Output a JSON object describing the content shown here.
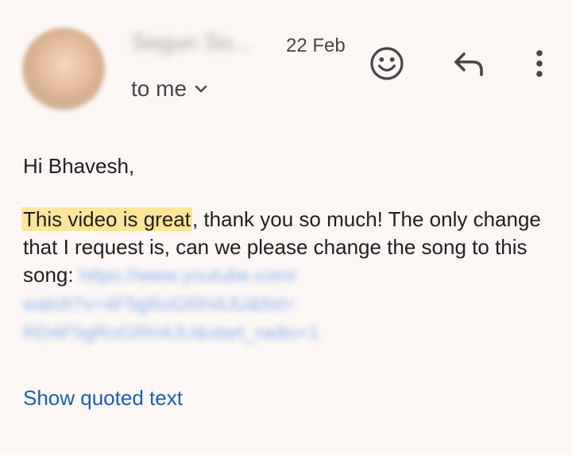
{
  "email": {
    "sender_name": "Segun So...",
    "date": "22 Feb",
    "recipient": "to me",
    "greeting": "Hi Bhavesh,",
    "body": {
      "highlighted": "This video is great",
      "rest": ", thank you so much! The only change that I request is, can we please change the song to this song:",
      "link_line_1": "https://www.youtube.com/",
      "link_line_2": "watch?v=4F5gRoGRH4JU&list=",
      "link_line_3": "RD4F5gRoGRH4JU&start_radio=1"
    },
    "show_quoted": "Show quoted text"
  },
  "icons": {
    "avatar": "sender-avatar",
    "emoji": "add-reaction-icon",
    "reply": "reply-icon",
    "more": "more-vertical-icon",
    "chevron": "chevron-down-icon"
  },
  "colors": {
    "background": "#fcf7f4",
    "text": "#1f1f1f",
    "secondary_text": "#444746",
    "highlight": "#fde59a",
    "link": "#1a5fb4",
    "blurred_link": "#8fb3f0"
  }
}
